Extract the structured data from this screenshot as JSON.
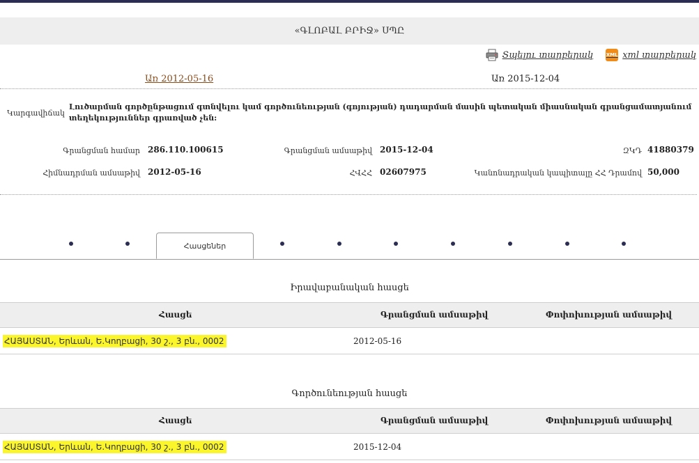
{
  "company": {
    "title": "«ԳԼՈԲԱԼ ԲՐԻՋ» ՍՊԸ"
  },
  "actions": {
    "print_label": "Տպելու տարբերակ",
    "xml_label": "xml տարբերակ",
    "xml_icon_text": "XML"
  },
  "dates": {
    "from_link": "Առ 2012-05-16",
    "current": "Առ 2015-12-04"
  },
  "status": {
    "label": "Կարգավիճակ",
    "text": "Լուծարման գործընթացում գտնվելու կամ գործունեության (գոյության) դադարման մասին պետական միասնական գրանցամատյանում տեղեկություններ գրառված չեն:"
  },
  "fields": {
    "reg_number_label": "Գրանցման համար",
    "reg_number": "286.110.100615",
    "reg_date_label": "Գրանցման ամսաթիվ",
    "reg_date": "2015-12-04",
    "zkd_label": "ԶԿԴ",
    "zkd": "41880379",
    "founding_date_label": "Հիմնադրման ամսաթիվ",
    "founding_date": "2012-05-16",
    "hvhh_label": "ՀՎՀՀ",
    "hvhh": "02607975",
    "capital_label": "Կանոնադրական կապիտալը ՀՀ Դրամով",
    "capital": "50,000"
  },
  "tabs": {
    "active_label": "Հասցեներ"
  },
  "legal_address": {
    "title": "Իրավաբանական հասցե",
    "headers": {
      "address": "Հասցե",
      "reg_date": "Գրանցման ամսաթիվ",
      "change_date": "Փոփոխության ամսաթիվ"
    },
    "rows": [
      {
        "address": "ՀԱՅԱՍՏԱՆ, Երևան, Ե.Կողբացի, 30 շ., 3 բն., 0002",
        "reg_date": "2012-05-16",
        "change_date": ""
      }
    ]
  },
  "business_address": {
    "title": "Գործունեության հասցե",
    "headers": {
      "address": "Հասցե",
      "reg_date": "Գրանցման ամսաթիվ",
      "change_date": "Փոփոխության ամսաթիվ"
    },
    "rows": [
      {
        "address": "ՀԱՅԱՍՏԱՆ, Երևան, Ե.Կողբացի, 30 շ., 3 բն., 0002",
        "reg_date": "2015-12-04",
        "change_date": ""
      }
    ]
  },
  "colors": {
    "accent": "#2b2d52",
    "highlight": "#fbf62c",
    "header_bg": "#eeeeee",
    "link": "#8a4a18",
    "xml_icon": "#f08c1a"
  }
}
